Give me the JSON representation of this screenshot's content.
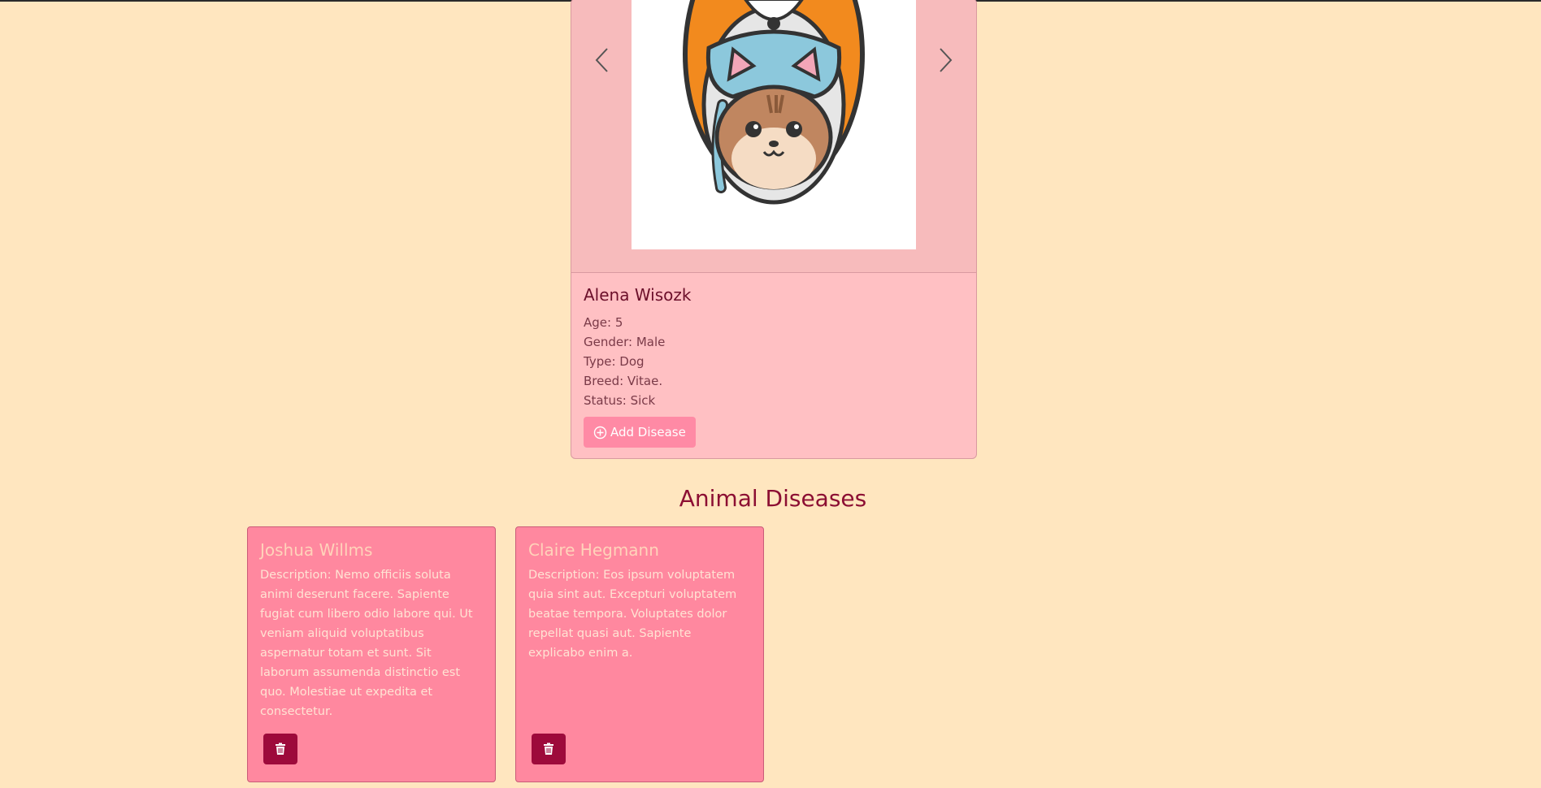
{
  "animal": {
    "name": "Alena Wisozk",
    "age": "Age: 5",
    "gender": "Gender: Male",
    "type": "Type: Dog",
    "breed": "Breed: Vitae.",
    "status": "Status: Sick",
    "add_disease_label": "Add Disease"
  },
  "diseases_section": {
    "title": "Animal Diseases",
    "items": [
      {
        "name": "Joshua Willms",
        "description": "Description: Nemo officiis soluta animi deserunt facere. Sapiente fugiat cum libero odio labore qui. Ut veniam aliquid voluptatibus aspernatur totam et sunt. Sit laborum assumenda distinctio est quo. Molestiae ut expedita et consectetur."
      },
      {
        "name": "Claire Hegmann",
        "description": "Description: Eos ipsum voluptatem quia sint aut. Excepturi voluptatem beatae tempora. Voluptates dolor repellat quasi aut. Sapiente explicabo enim a."
      }
    ]
  },
  "icons": {
    "prev": "chevron-left-icon",
    "next": "chevron-right-icon",
    "add": "plus-circle-icon",
    "delete": "trash-icon"
  },
  "colors": {
    "page_background": "#ffe6bf",
    "card_background": "#ffc0c3",
    "disease_card_background": "#ff889f",
    "accent_button": "#ff8aa5",
    "delete_button": "#9d0a3b",
    "heading": "#8c0f33"
  }
}
